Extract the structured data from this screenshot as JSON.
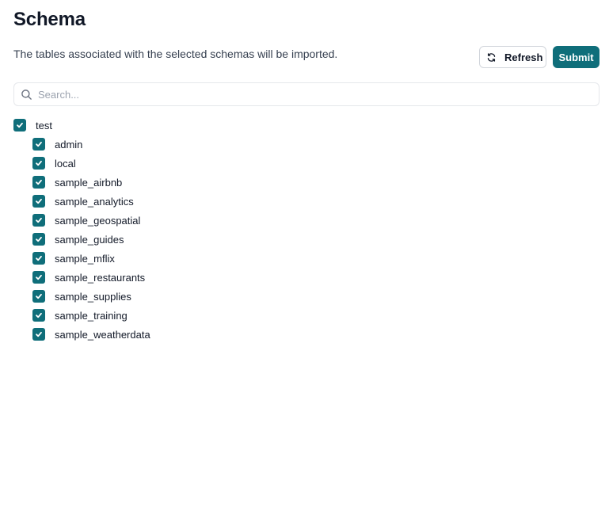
{
  "page": {
    "title": "Schema",
    "description": "The tables associated with the selected schemas will be imported."
  },
  "actions": {
    "refresh_label": "Refresh",
    "refresh_icon": "refresh-icon",
    "submit_label": "Submit"
  },
  "search": {
    "placeholder": "Search...",
    "value": "",
    "icon": "search-icon"
  },
  "tree": {
    "root": {
      "label": "test",
      "checked": true
    },
    "children": [
      {
        "label": "admin",
        "checked": true
      },
      {
        "label": "local",
        "checked": true
      },
      {
        "label": "sample_airbnb",
        "checked": true
      },
      {
        "label": "sample_analytics",
        "checked": true
      },
      {
        "label": "sample_geospatial",
        "checked": true
      },
      {
        "label": "sample_guides",
        "checked": true
      },
      {
        "label": "sample_mflix",
        "checked": true
      },
      {
        "label": "sample_restaurants",
        "checked": true
      },
      {
        "label": "sample_supplies",
        "checked": true
      },
      {
        "label": "sample_training",
        "checked": true
      },
      {
        "label": "sample_weatherdata",
        "checked": true
      }
    ]
  },
  "colors": {
    "accent": "#0f6e7a",
    "text": "#111827",
    "muted": "#374151",
    "border": "#d1d5db"
  }
}
